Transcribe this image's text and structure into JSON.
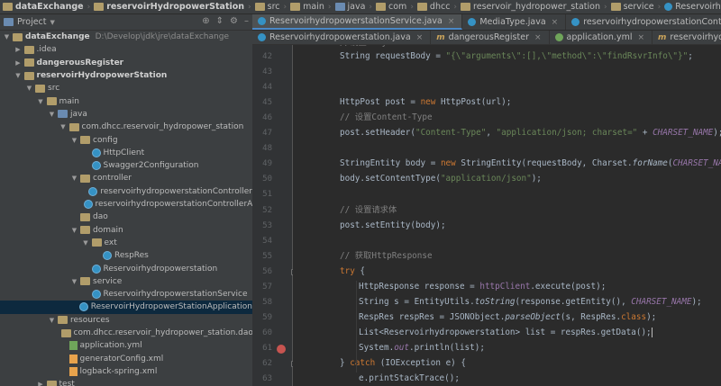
{
  "breadcrumb": [
    "dataExchange",
    "reservoirHydropowerStation",
    "src",
    "main",
    "java",
    "com",
    "dhcc",
    "reservoir_hydropower_station",
    "service",
    "ReservoirhydropowerstationService"
  ],
  "project_panel": {
    "title": "Project",
    "tree": [
      {
        "label": "dataExchange",
        "path": "D:\\Develop\\jdk\\jre\\dataExchange",
        "arrow": "▼",
        "indent": 0,
        "icon": "folder",
        "bold": true
      },
      {
        "label": ".idea",
        "arrow": "▶",
        "indent": 1,
        "icon": "folder"
      },
      {
        "label": "dangerousRegister",
        "arrow": "▶",
        "indent": 1,
        "icon": "folder",
        "bold": true
      },
      {
        "label": "reservoirHydropowerStation",
        "arrow": "▼",
        "indent": 1,
        "icon": "folder",
        "bold": true
      },
      {
        "label": "src",
        "arrow": "▼",
        "indent": 2,
        "icon": "folder"
      },
      {
        "label": "main",
        "arrow": "▼",
        "indent": 3,
        "icon": "folder"
      },
      {
        "label": "java",
        "arrow": "▼",
        "indent": 4,
        "icon": "folder-blue"
      },
      {
        "label": "com.dhcc.reservoir_hydropower_station",
        "arrow": "▼",
        "indent": 5,
        "icon": "folder"
      },
      {
        "label": "config",
        "arrow": "▼",
        "indent": 6,
        "icon": "folder"
      },
      {
        "label": "HttpClient",
        "arrow": "",
        "indent": 7,
        "icon": "class"
      },
      {
        "label": "Swagger2Configuration",
        "arrow": "",
        "indent": 7,
        "icon": "class"
      },
      {
        "label": "controller",
        "arrow": "▼",
        "indent": 6,
        "icon": "folder"
      },
      {
        "label": "reservoirhydropowerstationController",
        "arrow": "",
        "indent": 7,
        "icon": "class"
      },
      {
        "label": "reservoirhydropowerstationControllerApi",
        "arrow": "",
        "indent": 7,
        "icon": "class"
      },
      {
        "label": "dao",
        "arrow": "",
        "indent": 6,
        "icon": "folder"
      },
      {
        "label": "domain",
        "arrow": "▼",
        "indent": 6,
        "icon": "folder"
      },
      {
        "label": "ext",
        "arrow": "▼",
        "indent": 7,
        "icon": "folder"
      },
      {
        "label": "RespRes",
        "arrow": "",
        "indent": 8,
        "icon": "class"
      },
      {
        "label": "Reservoirhydropowerstation",
        "arrow": "",
        "indent": 7,
        "icon": "class"
      },
      {
        "label": "service",
        "arrow": "▼",
        "indent": 6,
        "icon": "folder"
      },
      {
        "label": "ReservoirhydropowerstationService",
        "arrow": "",
        "indent": 7,
        "icon": "class"
      },
      {
        "label": "ReservoirHydropowerStationApplication",
        "arrow": "",
        "indent": 6,
        "icon": "class",
        "selected": true
      },
      {
        "label": "resources",
        "arrow": "▼",
        "indent": 4,
        "icon": "folder"
      },
      {
        "label": "com.dhcc.reservoir_hydropower_station.dao",
        "arrow": "",
        "indent": 5,
        "icon": "folder"
      },
      {
        "label": "application.yml",
        "arrow": "",
        "indent": 5,
        "icon": "yml"
      },
      {
        "label": "generatorConfig.xml",
        "arrow": "",
        "indent": 5,
        "icon": "xml"
      },
      {
        "label": "logback-spring.xml",
        "arrow": "",
        "indent": 5,
        "icon": "xml"
      },
      {
        "label": "test",
        "arrow": "▶",
        "indent": 3,
        "icon": "folder"
      }
    ]
  },
  "tabs_row1": [
    {
      "label": "ReservoirhydropowerstationService.java",
      "icon": "class",
      "active": true
    },
    {
      "label": "MediaType.java",
      "icon": "class"
    },
    {
      "label": "reservoirhydropowerstationController.java",
      "icon": "class"
    }
  ],
  "tabs_row2": [
    {
      "label": "Reservoirhydropowerstation.java",
      "icon": "class"
    },
    {
      "label": "dangerousRegister",
      "icon": "m"
    },
    {
      "label": "application.yml",
      "icon": "yml"
    },
    {
      "label": "reservoirhydropowerstatio",
      "icon": "m"
    }
  ],
  "editor": {
    "lines": [
      {
        "n": "42",
        "html": "String requestBody = <span class=\"str\">\"{\\\"arguments\\\":[],\\\"method\\\":\\\"findRsvrInfo\\\"}\"</span>;",
        "indent": 0
      },
      {
        "n": "43",
        "html": "",
        "indent": 0
      },
      {
        "n": "44",
        "html": "",
        "indent": 0
      },
      {
        "n": "45",
        "html": "HttpPost post = <span class=\"kw\">new</span> HttpPost(url);",
        "indent": 0
      },
      {
        "n": "46",
        "html": "<span class=\"cm\">// 设置Content-Type</span>",
        "indent": 0
      },
      {
        "n": "47",
        "html": "post.setHeader(<span class=\"str\">\"Content-Type\"</span>, <span class=\"str\">\"application/json; charset=\"</span> + <span class=\"fld\">CHARSET_NAME</span>);",
        "indent": 0
      },
      {
        "n": "48",
        "html": "",
        "indent": 0
      },
      {
        "n": "49",
        "html": "StringEntity body = <span class=\"kw\">new</span> StringEntity(requestBody, Charset.<span class=\"it\">forName</span>(<span class=\"fld\">CHARSET_NAME</span>));",
        "indent": 0
      },
      {
        "n": "50",
        "html": "body.setContentType(<span class=\"str\">\"application/json\"</span>);",
        "indent": 0
      },
      {
        "n": "51",
        "html": "",
        "indent": 0
      },
      {
        "n": "52",
        "html": "<span class=\"cm\">// 设置请求体</span>",
        "indent": 0
      },
      {
        "n": "53",
        "html": "post.setEntity(body);",
        "indent": 0
      },
      {
        "n": "54",
        "html": "",
        "indent": 0
      },
      {
        "n": "55",
        "html": "<span class=\"cm\">// 获取HttpResponse</span>",
        "indent": 0
      },
      {
        "n": "56",
        "html": "<span class=\"kw\">try</span> {",
        "indent": 0,
        "fold": true
      },
      {
        "n": "57",
        "html": "HttpResponse response = <span class=\"fld2\">httpClient</span>.execute(post);",
        "indent": 1
      },
      {
        "n": "58",
        "html": "String s = EntityUtils.<span class=\"it\">toString</span>(response.getEntity(), <span class=\"fld\">CHARSET_NAME</span>);",
        "indent": 1
      },
      {
        "n": "59",
        "html": "RespRes respRes = JSONObject.<span class=\"it\">parseObject</span>(s, RespRes.<span class=\"kw\">class</span>);",
        "indent": 1
      },
      {
        "n": "60",
        "html": "List&lt;Reservoirhydropowerstation&gt; list = respRes.getData();<span class=\"caret\"></span>",
        "indent": 1
      },
      {
        "n": "61",
        "html": "System.<span class=\"fld\">out</span>.println(list);",
        "indent": 1,
        "breakpoint": true
      },
      {
        "n": "62",
        "html": "} <span class=\"kw\">catch</span> (IOException e) {",
        "indent": 0,
        "fold": true
      },
      {
        "n": "63",
        "html": "e.printStackTrace();",
        "indent": 1
      }
    ],
    "top_partial": "//设置body"
  }
}
